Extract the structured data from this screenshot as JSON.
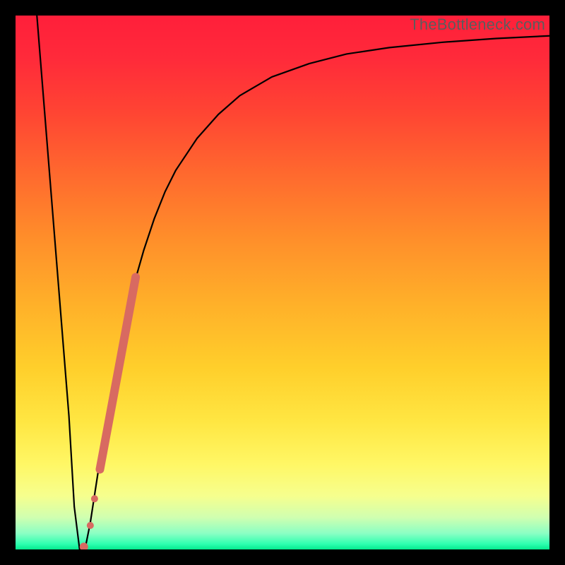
{
  "watermark": "TheBottleneck.com",
  "colors": {
    "curve_stroke": "#000000",
    "marker_fill": "#d86a61",
    "frame": "#000000"
  },
  "chart_data": {
    "type": "line",
    "title": "",
    "xlabel": "",
    "ylabel": "",
    "xlim": [
      0,
      100
    ],
    "ylim": [
      0,
      100
    ],
    "grid": false,
    "series": [
      {
        "name": "bottleneck-curve",
        "x": [
          4,
          6,
          8,
          10,
          11,
          12,
          13,
          14,
          16,
          18,
          20,
          22,
          24,
          26,
          28,
          30,
          34,
          38,
          42,
          48,
          55,
          62,
          70,
          80,
          90,
          100
        ],
        "y": [
          100,
          75,
          50,
          25,
          8,
          0,
          0,
          5,
          18,
          30,
          40,
          49,
          56,
          62,
          67,
          71,
          77,
          81.5,
          85,
          88.5,
          91,
          92.8,
          94,
          95,
          95.7,
          96.2
        ]
      }
    ],
    "markers": [
      {
        "name": "segment",
        "type": "line",
        "x": [
          15.8,
          22.5
        ],
        "y": [
          15,
          51
        ],
        "width": 12
      },
      {
        "name": "dot-lower-1",
        "type": "point",
        "x": 14.8,
        "y": 9.5,
        "r": 5
      },
      {
        "name": "dot-lower-2",
        "type": "point",
        "x": 14.0,
        "y": 4.5,
        "r": 5
      },
      {
        "name": "dot-bottom",
        "type": "point",
        "x": 12.8,
        "y": 0.5,
        "r": 6
      }
    ]
  }
}
